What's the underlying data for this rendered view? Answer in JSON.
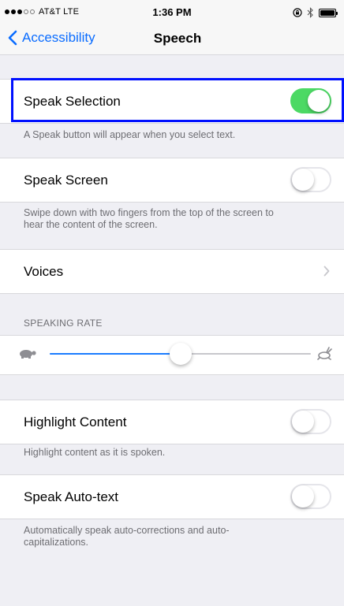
{
  "status_bar": {
    "carrier": "AT&T  LTE",
    "time": "1:36 PM",
    "signal_bars_filled": 3,
    "signal_bars_total": 5
  },
  "nav": {
    "back_label": "Accessibility",
    "title": "Speech"
  },
  "speak_selection": {
    "label": "Speak Selection",
    "enabled": true,
    "footer": "A Speak button will appear when you select text."
  },
  "speak_screen": {
    "label": "Speak Screen",
    "enabled": false,
    "footer_line1": "Swipe down with two fingers from the top of the screen to",
    "footer_line2": "hear the content of the screen."
  },
  "voices": {
    "label": "Voices"
  },
  "speaking_rate": {
    "header": "SPEAKING RATE",
    "value": 0.5
  },
  "highlight_content": {
    "label": "Highlight Content",
    "enabled": false,
    "footer": "Highlight content as it is spoken."
  },
  "speak_autotext": {
    "label": "Speak Auto-text",
    "enabled": false,
    "footer_line1": "Automatically speak auto-corrections and auto-",
    "footer_line2": "capitalizations."
  },
  "colors": {
    "accent": "#0a6cff",
    "switch_on": "#4cd964",
    "highlight": "#0010ff",
    "background": "#efeff4"
  }
}
